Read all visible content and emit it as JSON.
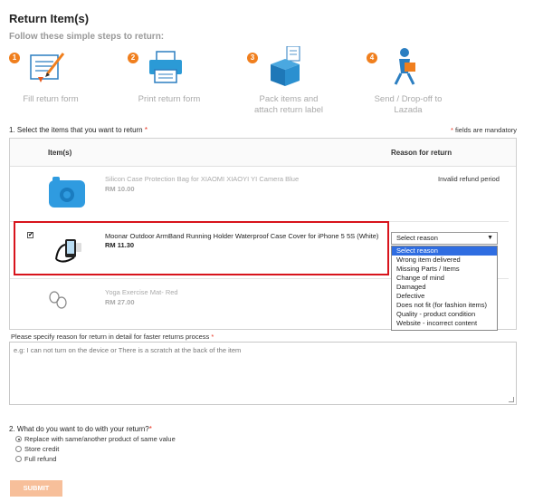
{
  "page": {
    "title": "Return Item(s)",
    "subtitle": "Follow these simple steps to return:"
  },
  "steps": [
    {
      "num": "1",
      "label_line1": "Fill return form",
      "label_line2": "",
      "icon": "form-pen-icon"
    },
    {
      "num": "2",
      "label_line1": "Print return form",
      "label_line2": "",
      "icon": "printer-icon"
    },
    {
      "num": "3",
      "label_line1": "Pack items and",
      "label_line2": "attach return label",
      "icon": "box-icon"
    },
    {
      "num": "4",
      "label_line1": "Send / Drop-off to",
      "label_line2": "Lazada",
      "icon": "courier-icon"
    }
  ],
  "section1": {
    "label": "1. Select the items that you want to return",
    "required_mark": "*",
    "mandatory_note": "fields are mandatory"
  },
  "table": {
    "col_items": "Item(s)",
    "col_reason": "Reason for return",
    "rows": [
      {
        "name": "Silicon Case Protection Bag for XIAOMI XIAOYI YI Camera Blue",
        "price": "RM 10.00",
        "reason": "Invalid refund period",
        "checked": false
      },
      {
        "name": "Moonar Outdoor ArmBand Running Holder Waterproof Case Cover for iPhone 5 5S (White)",
        "price": "RM 11.30",
        "reason": "",
        "checked": true
      },
      {
        "name": "Yoga Exercise Mat- Red",
        "price": "RM 27.00",
        "reason": "",
        "checked": false
      }
    ]
  },
  "reason_select": {
    "value": "Select reason",
    "options": [
      "Select reason",
      "Wrong item delivered",
      "Missing Parts / Items",
      "Change of mind",
      "Damaged",
      "Defective",
      "Does not fit (for fashion items)",
      "Quality - product condition",
      "Website - incorrect content"
    ]
  },
  "detail": {
    "label": "Please specify reason for return in detail for faster returns process",
    "required_mark": "*",
    "placeholder": "e.g: I can not turn on the device or There is a scratch at the back of the item"
  },
  "section2": {
    "label": "2. What do you want to do with your return?",
    "required_mark": "*",
    "options": [
      {
        "label": "Replace with same/another product of same value",
        "selected": true
      },
      {
        "label": "Store credit",
        "selected": false
      },
      {
        "label": "Full refund",
        "selected": false
      }
    ]
  },
  "submit_label": "SUBMIT",
  "colors": {
    "accent": "#f07f1e",
    "highlight": "#d8141c",
    "dropdown_selected": "#2f6de1",
    "submit_bg": "#f7bf9a"
  }
}
